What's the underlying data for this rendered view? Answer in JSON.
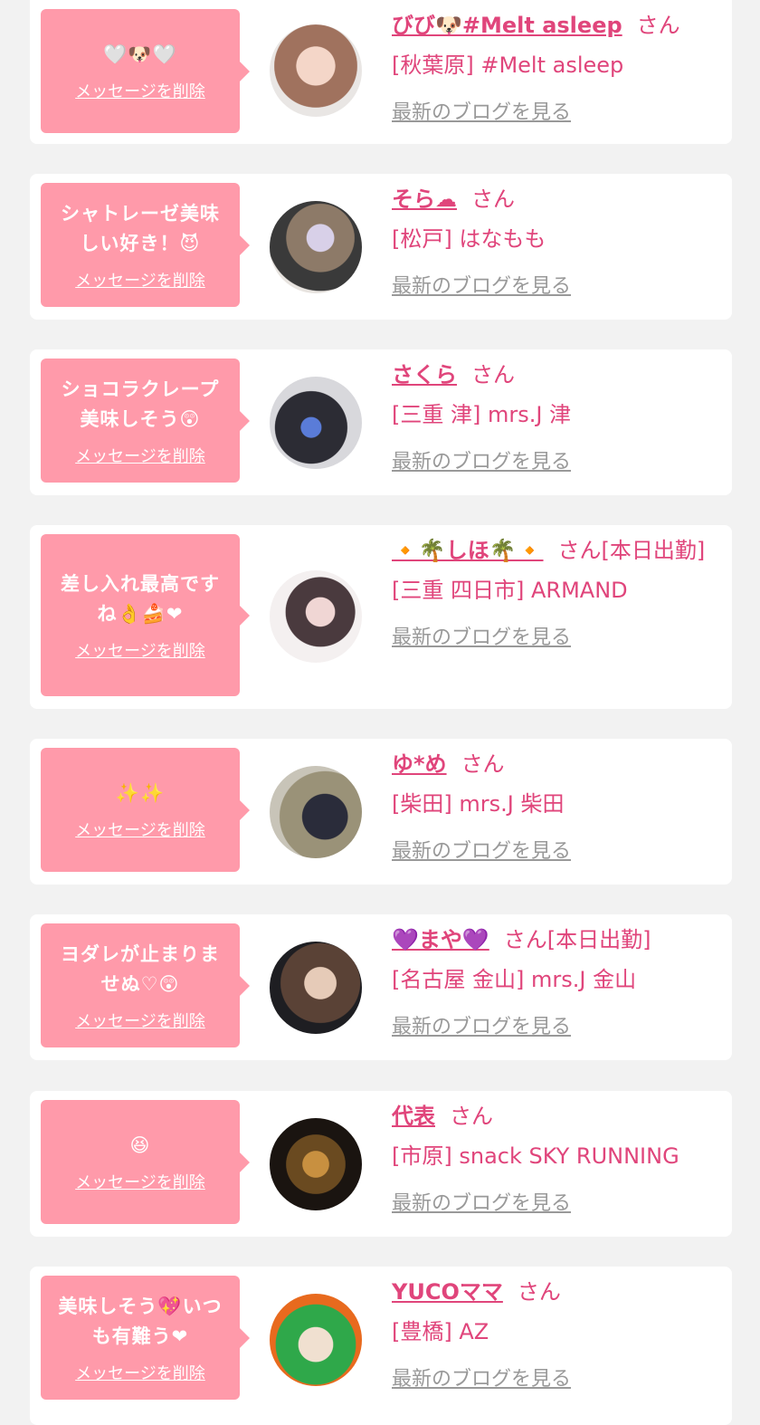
{
  "colors": {
    "accent": "#e0457b",
    "bubble": "#ff9aaa",
    "muted": "#999999"
  },
  "common": {
    "san": "さん",
    "delete_label": "メッセージを削除",
    "blog_label": "最新のブログを見る"
  },
  "messages": [
    {
      "message": "🤍🐶🤍",
      "name": "びび🐶#Melt asleep",
      "suffix": "さん",
      "shop": "[秋葉原] #Melt asleep"
    },
    {
      "message": "シャトレーゼ美味しい好き！😈",
      "name": "そら☁",
      "suffix": "さん",
      "shop": "[松戸] はなもも"
    },
    {
      "message": "ショコラクレープ美味しそう😲",
      "name": "さくら",
      "suffix": "さん",
      "shop": "[三重 津] mrs.J 津"
    },
    {
      "message": "差し入れ最高ですね👌🍰❤",
      "name": "🔸🌴しほ🌴🔸",
      "suffix": "さん[本日出勤]",
      "shop": "[三重 四日市] ARMAND"
    },
    {
      "message": "✨✨",
      "name": "ゆ*め",
      "suffix": "さん",
      "shop": "[柴田] mrs.J 柴田"
    },
    {
      "message": "ヨダレが止まりませぬ♡😲",
      "name": "💜まや💜",
      "suffix": "さん[本日出勤]",
      "shop": "[名古屋 金山] mrs.J 金山"
    },
    {
      "message": "😆",
      "name": "代表",
      "suffix": "さん",
      "shop": "[市原] snack SKY RUNNING"
    },
    {
      "message": "美味しそう💖いつも有難う❤",
      "name": "YUCOママ",
      "suffix": "さん",
      "shop": "[豊橋] AZ"
    }
  ]
}
